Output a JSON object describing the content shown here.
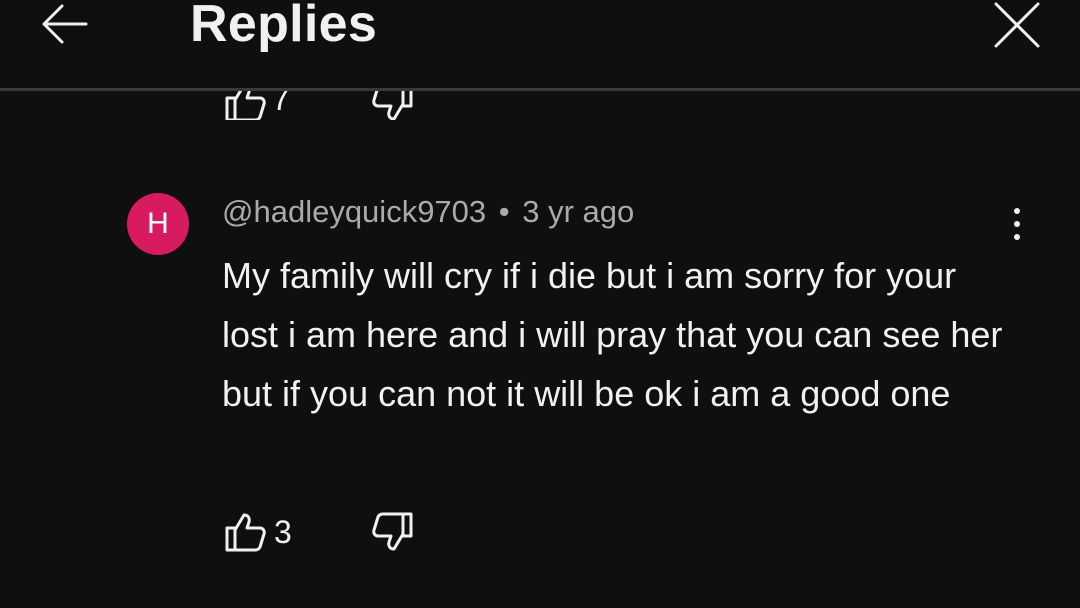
{
  "header": {
    "title": "Replies",
    "back_icon": "arrow-left-icon",
    "close_icon": "close-icon"
  },
  "previous_comment": {
    "like_count": "7"
  },
  "comment": {
    "avatar_letter": "H",
    "avatar_color": "#d81b60",
    "author": "@hadleyquick9703",
    "separator": "•",
    "time": "3 yr ago",
    "text": "My family will cry if i die but i am sorry for your lost i am here and i will pray that you can see her but if you can not it will be ok i am a good one",
    "like_count": "3"
  },
  "colors": {
    "background": "#0f0f0f",
    "text": "#f1f1f1",
    "secondary_text": "#aaaaaa",
    "divider": "#3a3a3a"
  }
}
